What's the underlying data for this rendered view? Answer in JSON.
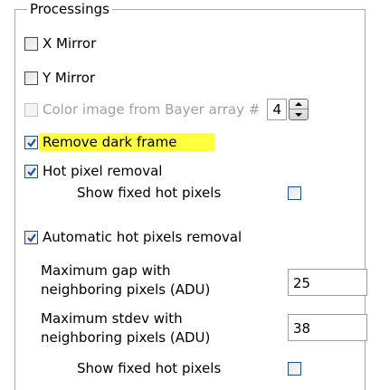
{
  "group": {
    "title": "Processings"
  },
  "checkboxes": {
    "x_mirror": {
      "label": "X Mirror",
      "checked": false
    },
    "y_mirror": {
      "label": "Y Mirror",
      "checked": false
    },
    "bayer": {
      "label": "Color image from Bayer array #",
      "checked": false,
      "disabled": true,
      "spin_value": "4"
    },
    "dark_frame": {
      "label": "Remove dark frame",
      "checked": true,
      "highlighted": true,
      "highlight_color": "#ffff3c"
    },
    "hot_pixel": {
      "label": "Hot pixel removal",
      "checked": true
    },
    "show_fixed_1": {
      "label": "Show fixed hot pixels",
      "checked": false
    },
    "auto_hot": {
      "label": "Automatic hot pixels removal",
      "checked": true
    },
    "show_fixed_2": {
      "label": "Show fixed hot pixels",
      "checked": false
    }
  },
  "fields": {
    "max_gap": {
      "label_line1": "Maximum gap with",
      "label_line2": "neighboring pixels (ADU)",
      "value": "25"
    },
    "max_stdev": {
      "label_line1": "Maximum stdev with",
      "label_line2": "neighboring pixels (ADU)",
      "value": "38"
    }
  },
  "colors": {
    "check": "#1f4fa8",
    "highlight": "#ffff3c",
    "disabled_text": "#a0a0a0"
  }
}
